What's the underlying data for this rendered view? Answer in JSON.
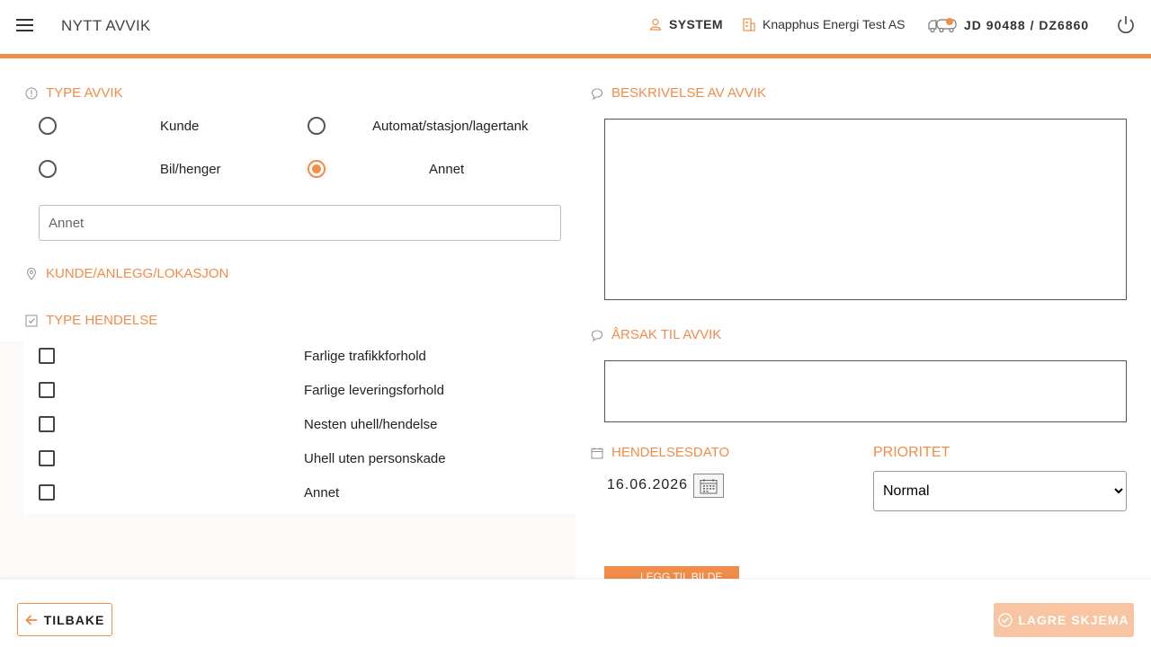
{
  "header": {
    "title": "NYTT AVVIK",
    "user": "SYSTEM",
    "company": "Knapphus Energi Test AS",
    "vehicle": "JD 90488 / DZ6860",
    "accent_color": "#f28c4a"
  },
  "type_avvik": {
    "title": "TYPE AVVIK",
    "options": [
      {
        "label": "Kunde",
        "checked": false
      },
      {
        "label": "Automat/stasjon/lagertank",
        "checked": false
      },
      {
        "label": "Bil/henger",
        "checked": false
      },
      {
        "label": "Annet",
        "checked": true
      }
    ],
    "other_placeholder": "Annet"
  },
  "kunde": {
    "title": "KUNDE/ANLEGG/LOKASJON"
  },
  "type_hendelse": {
    "title": "TYPE HENDELSE",
    "items": [
      {
        "label": "Farlige trafikkforhold",
        "checked": false
      },
      {
        "label": "Farlige leveringsforhold",
        "checked": false
      },
      {
        "label": "Nesten uhell/hendelse",
        "checked": false
      },
      {
        "label": "Uhell uten personskade",
        "checked": false
      },
      {
        "label": "Annet",
        "checked": false
      }
    ]
  },
  "beskrivelse": {
    "title": "BESKRIVELSE AV AVVIK"
  },
  "arsak": {
    "title": "ÅRSAK TIL AVVIK"
  },
  "hendelsesdato": {
    "title": "HENDELSESDATO",
    "value": "16.06.2026"
  },
  "prioritet": {
    "title": "PRIORITET",
    "selected": "Normal"
  },
  "photo": {
    "label": "LEGG TIL BILDE"
  },
  "footer": {
    "back_label": "TILBAKE",
    "save_label": "LAGRE SKJEMA"
  }
}
